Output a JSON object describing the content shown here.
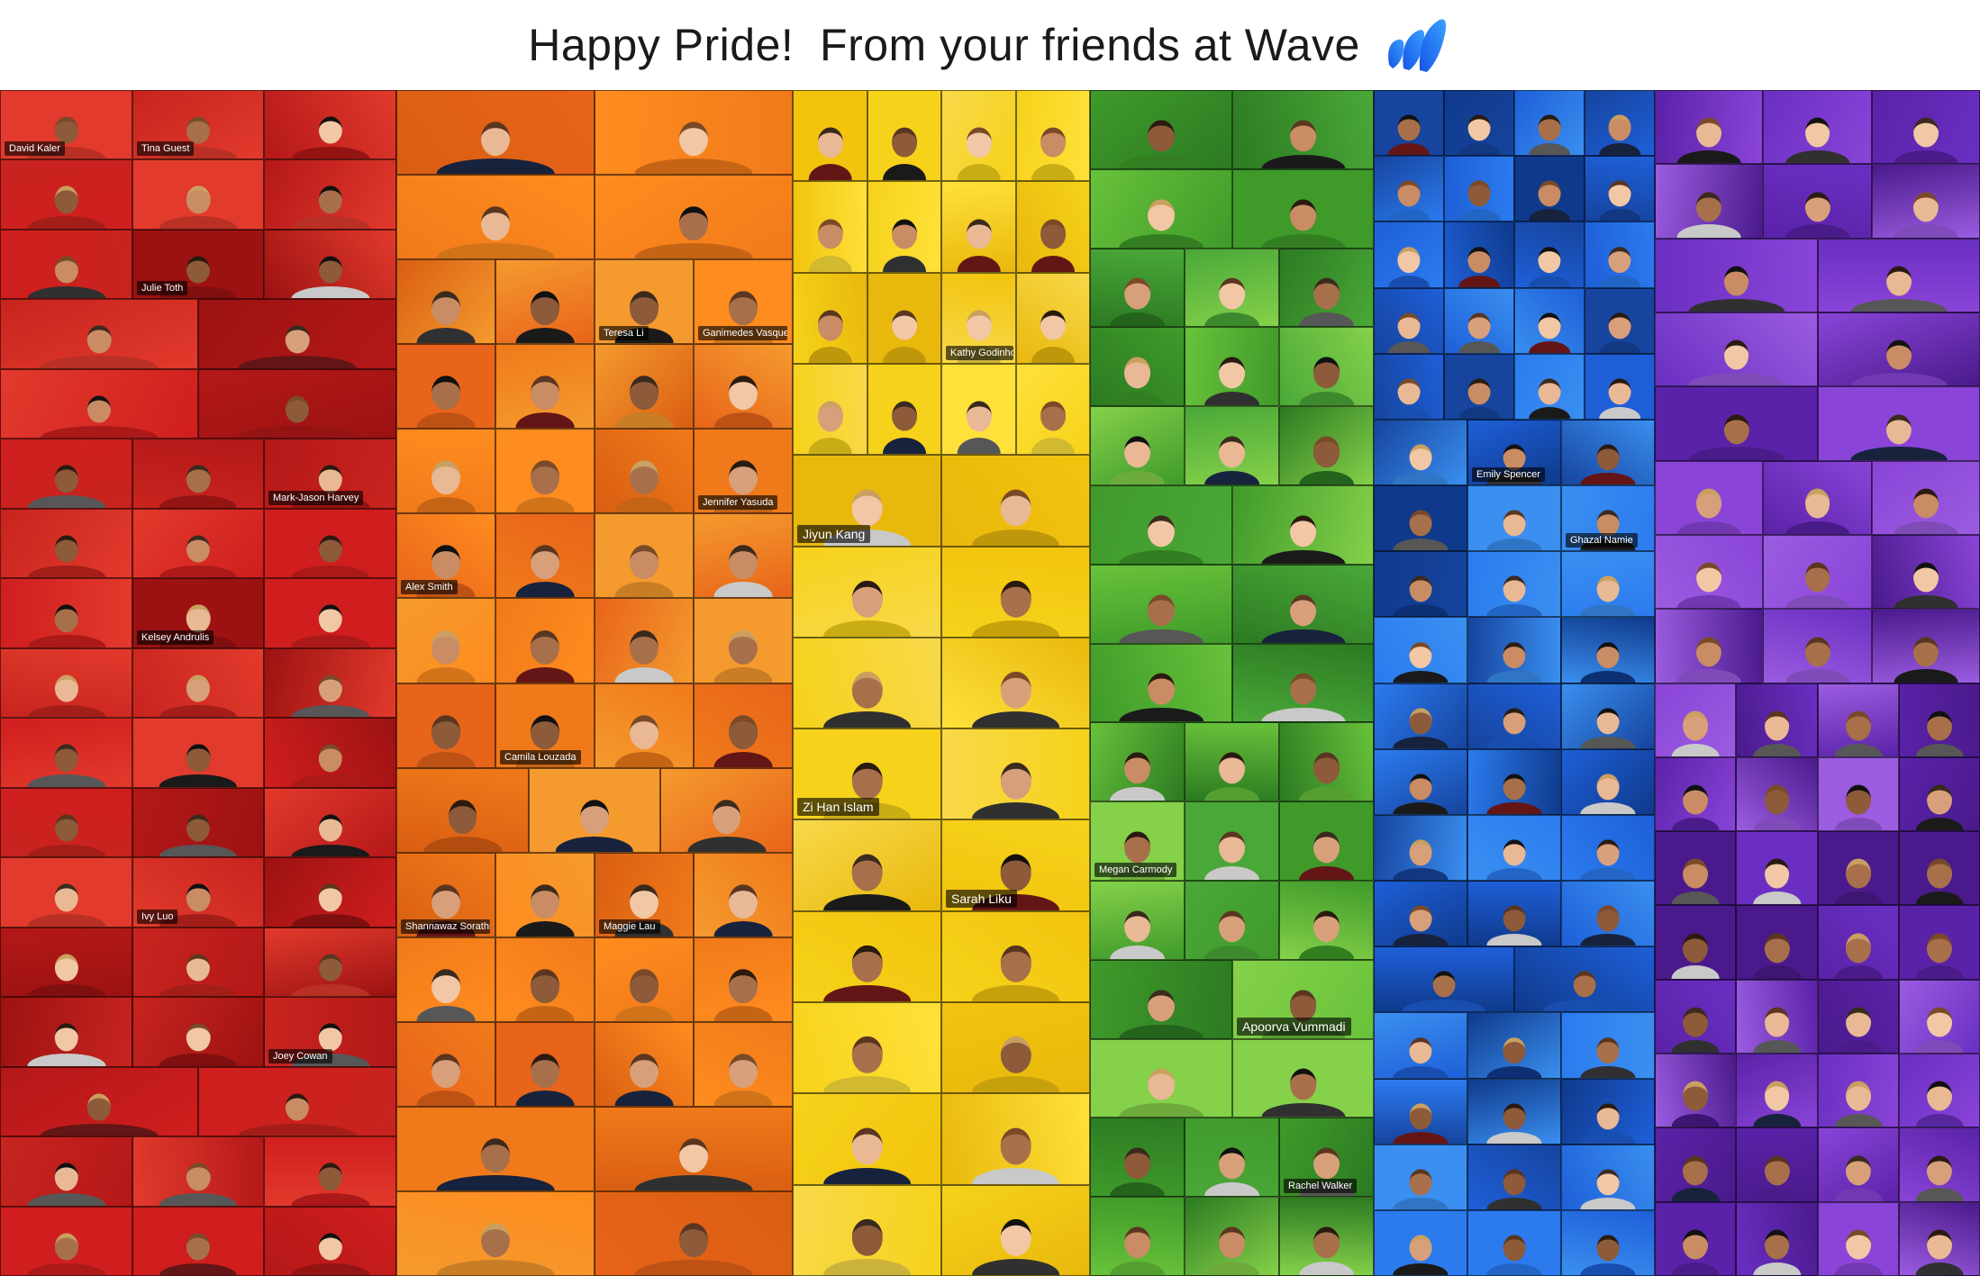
{
  "header": {
    "title": "Happy Pride!  From your friends at Wave",
    "logo_icon": "wave-logo-icon",
    "logo_color": "#1f6bff"
  },
  "columns": [
    {
      "name": "red",
      "colors": [
        "#d01e1e",
        "#b41818",
        "#e23a2c",
        "#9c1212",
        "#c8241f"
      ]
    },
    {
      "name": "orange",
      "colors": [
        "#f07a1a",
        "#ff8c1f",
        "#e8641a",
        "#f59a2e",
        "#d95e12"
      ]
    },
    {
      "name": "yellow",
      "colors": [
        "#f6d21a",
        "#ffe13a",
        "#f2c40e",
        "#f8d94a",
        "#e9b80c"
      ]
    },
    {
      "name": "green",
      "colors": [
        "#3f9a2a",
        "#68c23a",
        "#2c7a22",
        "#85d14a",
        "#4aa838"
      ]
    },
    {
      "name": "blue",
      "colors": [
        "#1e5fd8",
        "#2b7bef",
        "#16449e",
        "#3a8ff0",
        "#0f3a8c"
      ]
    },
    {
      "name": "purple",
      "colors": [
        "#6a2fc2",
        "#8a44d8",
        "#5a22a8",
        "#9b5ce0",
        "#4a1a8c"
      ]
    }
  ],
  "names": [
    "David Kaler",
    "Tina Guest",
    "Julie Toth",
    "Mark-Jason Harvey",
    "Kelsey Andrulis",
    "Ivy Luo",
    "Joey Cowan",
    "Teresa Li",
    "Ganimedes Vasquez",
    "Jennifer Yasuda",
    "Alex Smith",
    "Camila Louzada",
    "Shannawaz Sorathiya",
    "Maggie Lau",
    "Kathy Godinho",
    "Jiyun Kang",
    "Zi Han Islam",
    "Sarah Liku",
    "Megan Carmody",
    "Apoorva Vummadi",
    "Rachel Walker",
    "Emily Spencer",
    "Ghazal Namie"
  ]
}
